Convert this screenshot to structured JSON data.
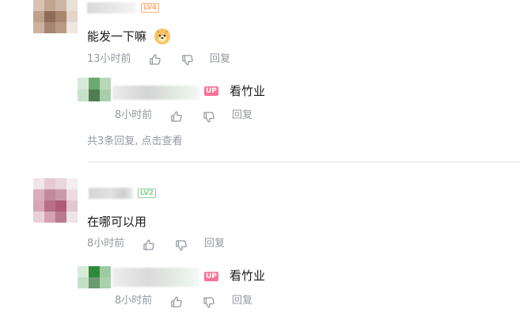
{
  "comments": [
    {
      "level": "LV4",
      "level_color": "#ffb27f",
      "text": "能发一下嘛",
      "emoji": "doge",
      "time": "13小时前",
      "reply_label": "回复",
      "reply": {
        "badge": "UP",
        "text": "看竹业",
        "time": "8小时前",
        "reply_label": "回复"
      },
      "more_replies": "共3条回复, 点击查看"
    },
    {
      "level": "LV2",
      "level_color": "#8bd29b",
      "text": "在哪可以用",
      "time": "8小时前",
      "reply_label": "回复",
      "reply": {
        "badge": "UP",
        "text": "看竹业",
        "time": "8小时前",
        "reply_label": "回复"
      }
    }
  ],
  "colors": {
    "meta": "#9499a0",
    "up_badge": "#fb7299",
    "divider": "#e3e5e7"
  }
}
